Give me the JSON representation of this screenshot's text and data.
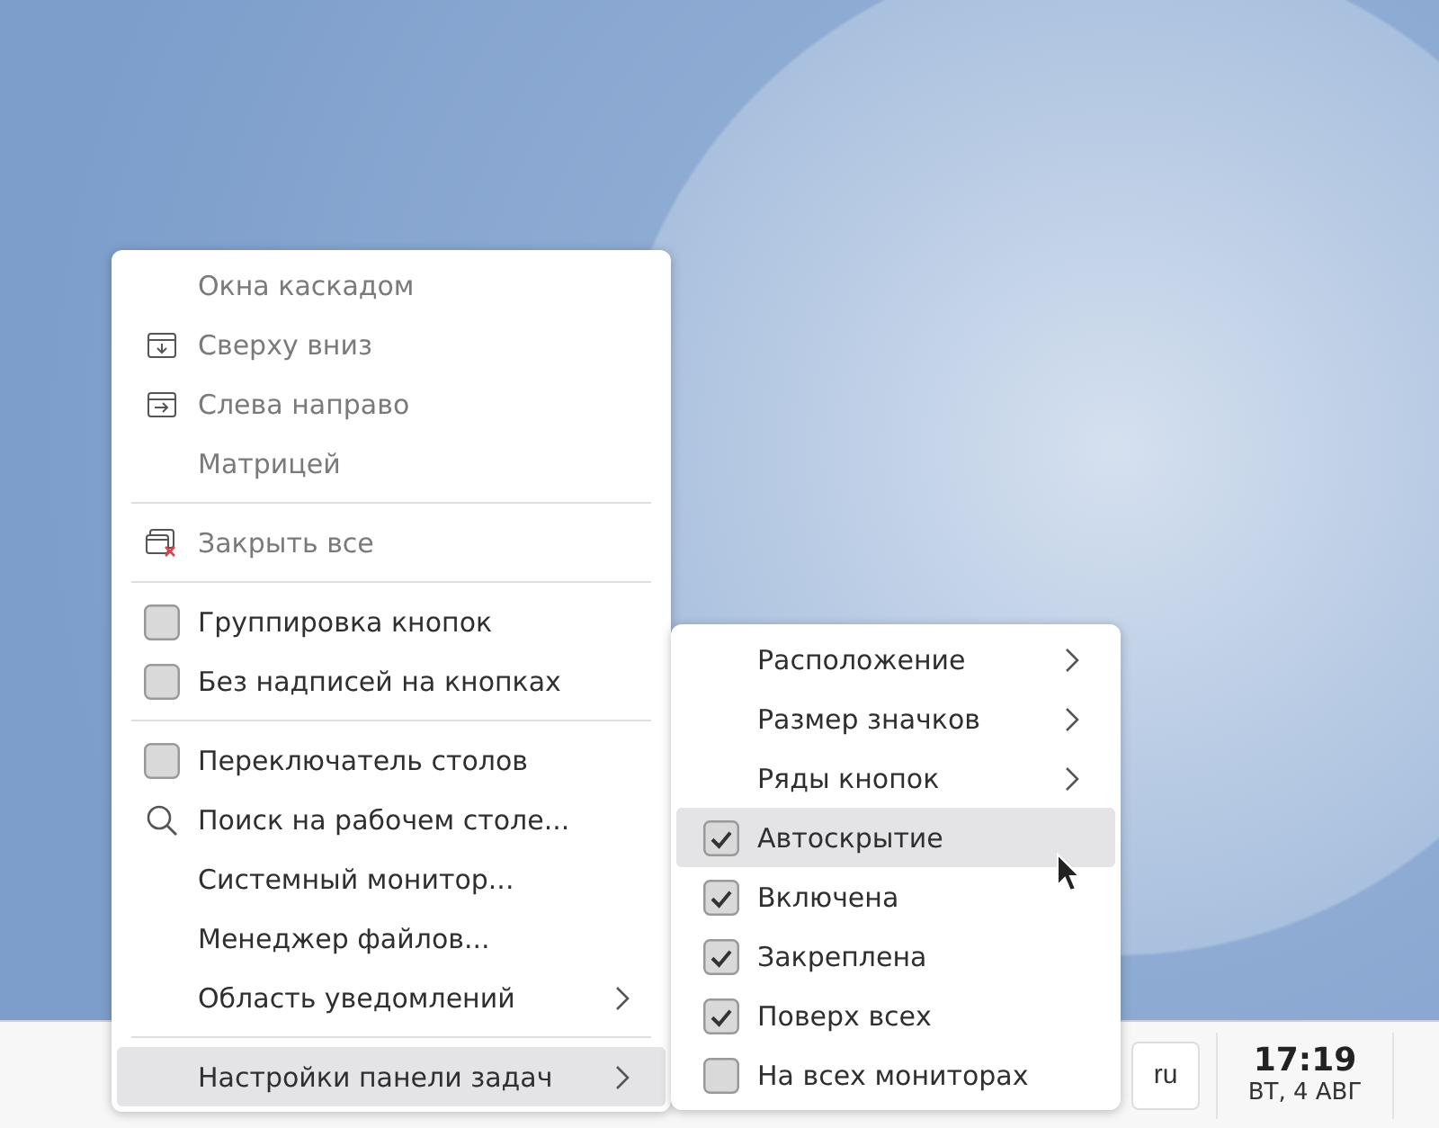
{
  "context_menu": {
    "sections": [
      [
        {
          "label": "Окна каскадом",
          "kind": "action",
          "disabled": true,
          "highlighted": false
        },
        {
          "label": "Сверху вниз",
          "kind": "action",
          "disabled": true,
          "highlighted": false
        },
        {
          "label": "Слева направо",
          "kind": "action",
          "disabled": true,
          "highlighted": false
        },
        {
          "label": "Матрицей",
          "kind": "action",
          "disabled": true,
          "highlighted": false
        }
      ],
      [
        {
          "label": "Закрыть все",
          "kind": "action",
          "disabled": true,
          "highlighted": false
        }
      ],
      [
        {
          "label": "Группировка кнопок",
          "kind": "checkbox",
          "checked": false,
          "disabled": false,
          "highlighted": false
        },
        {
          "label": "Без надписей на кнопках",
          "kind": "checkbox",
          "checked": false,
          "disabled": false,
          "highlighted": false
        }
      ],
      [
        {
          "label": "Переключатель столов",
          "kind": "checkbox",
          "checked": false,
          "disabled": false,
          "highlighted": false
        },
        {
          "label": "Поиск на рабочем столе...",
          "kind": "action",
          "disabled": false,
          "highlighted": false
        },
        {
          "label": "Системный монитор...",
          "kind": "action",
          "disabled": false,
          "highlighted": false
        },
        {
          "label": "Менеджер файлов...",
          "kind": "action",
          "disabled": false,
          "highlighted": false
        },
        {
          "label": "Область уведомлений",
          "kind": "submenu",
          "disabled": false,
          "highlighted": false
        }
      ],
      [
        {
          "label": "Настройки панели задач",
          "kind": "submenu",
          "disabled": false,
          "highlighted": true
        }
      ]
    ]
  },
  "submenu": {
    "items": [
      {
        "label": "Расположение",
        "kind": "submenu",
        "highlighted": false
      },
      {
        "label": "Размер значков",
        "kind": "submenu",
        "highlighted": false
      },
      {
        "label": "Ряды кнопок",
        "kind": "submenu",
        "highlighted": false
      },
      {
        "label": "Автоскрытие",
        "kind": "checkbox",
        "checked": true,
        "highlighted": true
      },
      {
        "label": "Включена",
        "kind": "checkbox",
        "checked": true,
        "highlighted": false
      },
      {
        "label": "Закреплена",
        "kind": "checkbox",
        "checked": true,
        "highlighted": false
      },
      {
        "label": "Поверх всех",
        "kind": "checkbox",
        "checked": true,
        "highlighted": false
      },
      {
        "label": "На всех мониторах",
        "kind": "checkbox",
        "checked": false,
        "highlighted": false
      }
    ]
  },
  "taskbar": {
    "keyboard_layout": "ru",
    "clock": {
      "time": "17:19",
      "date": "ВТ, 4 АВГ"
    }
  }
}
